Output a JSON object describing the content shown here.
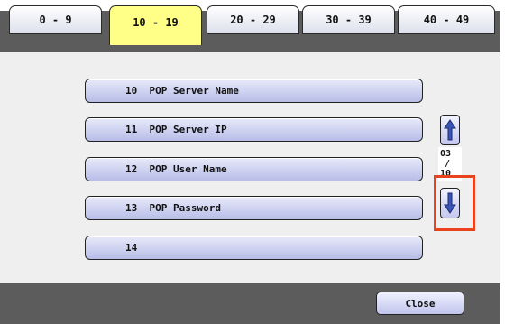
{
  "tabs": [
    {
      "label": "0 - 9",
      "active": false
    },
    {
      "label": "10 - 19",
      "active": true
    },
    {
      "label": "20 - 29",
      "active": false
    },
    {
      "label": "30 - 39",
      "active": false
    },
    {
      "label": "40 - 49",
      "active": false
    }
  ],
  "items": [
    {
      "label": "10  POP Server Name"
    },
    {
      "label": "11  POP Server IP"
    },
    {
      "label": "12  POP User Name"
    },
    {
      "label": "13  POP Password"
    },
    {
      "label": "14"
    }
  ],
  "pager": {
    "current": "03",
    "separator": "/",
    "total": "10",
    "up_icon": "arrow-up-icon",
    "down_icon": "arrow-down-icon"
  },
  "footer": {
    "close_label": "Close"
  },
  "colors": {
    "active_tab": "#ffff88",
    "highlight": "#e8431c",
    "frame": "#5c5c5c",
    "button_gradient_bottom": "#b8bde8"
  }
}
